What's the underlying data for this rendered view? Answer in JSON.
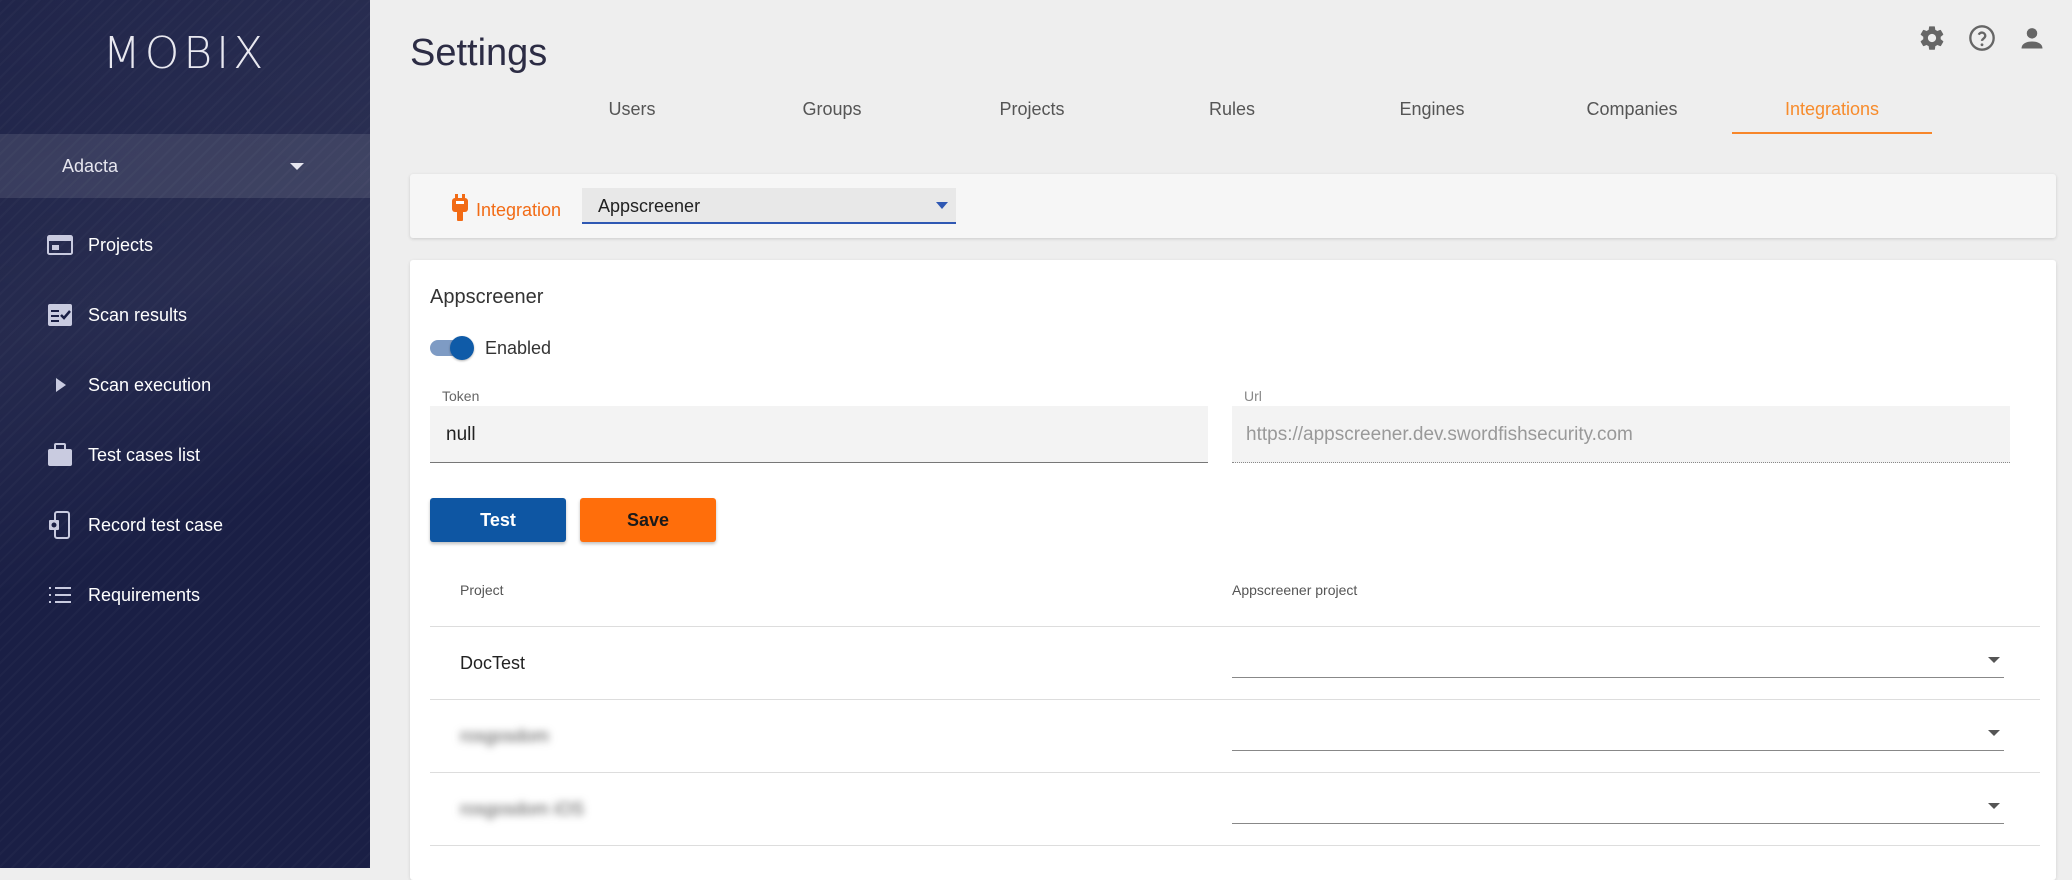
{
  "app": {
    "logo": "MOBIX",
    "company": "Adacta"
  },
  "sidebar": {
    "items": [
      {
        "label": "Projects",
        "icon": "projects-icon"
      },
      {
        "label": "Scan results",
        "icon": "scan-results-icon"
      },
      {
        "label": "Scan execution",
        "icon": "play-icon"
      },
      {
        "label": "Test cases list",
        "icon": "briefcase-icon"
      },
      {
        "label": "Record test case",
        "icon": "record-device-icon"
      },
      {
        "label": "Requirements",
        "icon": "list-icon"
      }
    ]
  },
  "header": {
    "title": "Settings",
    "icons": [
      "gear-icon",
      "help-icon",
      "account-icon"
    ]
  },
  "tabs": [
    {
      "label": "Users",
      "active": false
    },
    {
      "label": "Groups",
      "active": false
    },
    {
      "label": "Projects",
      "active": false
    },
    {
      "label": "Rules",
      "active": false
    },
    {
      "label": "Engines",
      "active": false
    },
    {
      "label": "Companies",
      "active": false
    },
    {
      "label": "Integrations",
      "active": true
    }
  ],
  "integration": {
    "label": "Integration",
    "selected": "Appscreener"
  },
  "main": {
    "section_title": "Appscreener",
    "enabled_label": "Enabled",
    "enabled": true,
    "token_label": "Token",
    "token_value": "null",
    "url_label": "Url",
    "url_value": "https://appscreener.dev.swordfishsecurity.com",
    "test_label": "Test",
    "save_label": "Save"
  },
  "table": {
    "columns": [
      "Project",
      "Appscreener project"
    ],
    "rows": [
      {
        "project": "DocTest",
        "appscreener_project": "",
        "blurred": false
      },
      {
        "project": "rosgosdom",
        "appscreener_project": "",
        "blurred": true
      },
      {
        "project": "rosgosdom iOS",
        "appscreener_project": "",
        "blurred": true
      }
    ]
  },
  "colors": {
    "accent": "#f7862a",
    "primary": "#0e56a3",
    "save": "#ff6e0b",
    "sidebar": "#1a1f45"
  }
}
